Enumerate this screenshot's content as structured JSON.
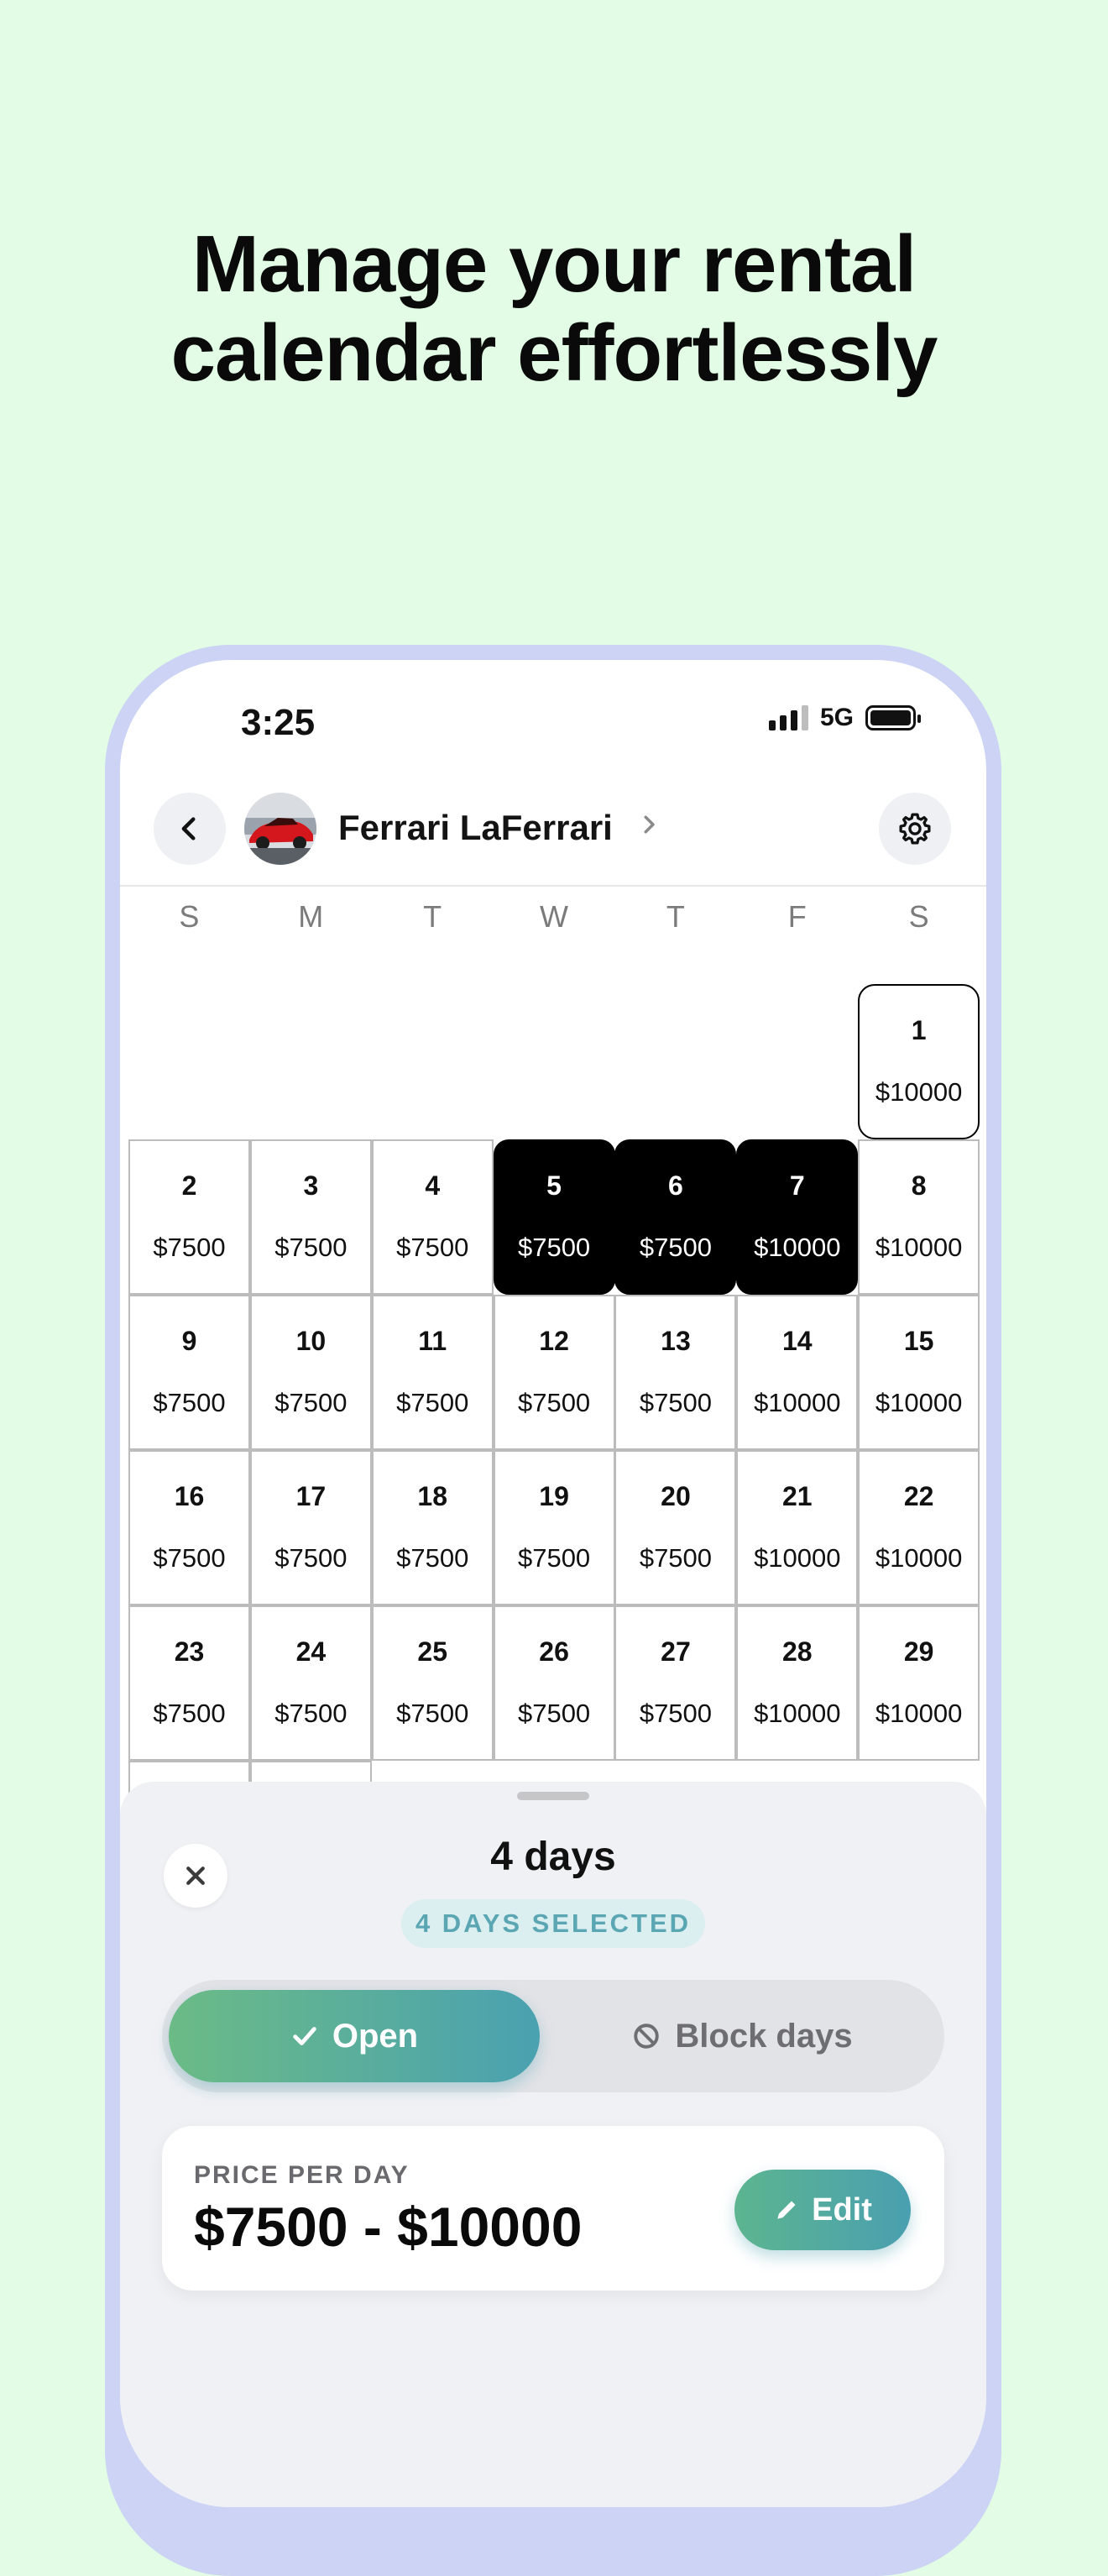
{
  "headline": {
    "line1": "Manage your rental",
    "line2": "calendar effortlessly"
  },
  "status_bar": {
    "time": "3:25",
    "network": "5G"
  },
  "header": {
    "car_name": "Ferrari LaFerrari"
  },
  "weekdays": [
    "S",
    "M",
    "T",
    "W",
    "T",
    "F",
    "S"
  ],
  "calendar": {
    "leading_blanks": 6,
    "days": [
      {
        "day": "1",
        "price": "$10000",
        "state": "today"
      },
      {
        "day": "2",
        "price": "$7500",
        "state": "normal"
      },
      {
        "day": "3",
        "price": "$7500",
        "state": "normal"
      },
      {
        "day": "4",
        "price": "$7500",
        "state": "normal"
      },
      {
        "day": "5",
        "price": "$7500",
        "state": "selected"
      },
      {
        "day": "6",
        "price": "$7500",
        "state": "selected"
      },
      {
        "day": "7",
        "price": "$10000",
        "state": "selected"
      },
      {
        "day": "8",
        "price": "$10000",
        "state": "normal"
      },
      {
        "day": "9",
        "price": "$7500",
        "state": "normal"
      },
      {
        "day": "10",
        "price": "$7500",
        "state": "normal"
      },
      {
        "day": "11",
        "price": "$7500",
        "state": "normal"
      },
      {
        "day": "12",
        "price": "$7500",
        "state": "normal"
      },
      {
        "day": "13",
        "price": "$7500",
        "state": "normal"
      },
      {
        "day": "14",
        "price": "$10000",
        "state": "normal"
      },
      {
        "day": "15",
        "price": "$10000",
        "state": "normal"
      },
      {
        "day": "16",
        "price": "$7500",
        "state": "normal"
      },
      {
        "day": "17",
        "price": "$7500",
        "state": "normal"
      },
      {
        "day": "18",
        "price": "$7500",
        "state": "normal"
      },
      {
        "day": "19",
        "price": "$7500",
        "state": "normal"
      },
      {
        "day": "20",
        "price": "$7500",
        "state": "normal"
      },
      {
        "day": "21",
        "price": "$10000",
        "state": "normal"
      },
      {
        "day": "22",
        "price": "$10000",
        "state": "normal"
      },
      {
        "day": "23",
        "price": "$7500",
        "state": "normal"
      },
      {
        "day": "24",
        "price": "$7500",
        "state": "normal"
      },
      {
        "day": "25",
        "price": "$7500",
        "state": "normal"
      },
      {
        "day": "26",
        "price": "$7500",
        "state": "normal"
      },
      {
        "day": "27",
        "price": "$7500",
        "state": "normal"
      },
      {
        "day": "28",
        "price": "$10000",
        "state": "normal"
      },
      {
        "day": "29",
        "price": "$10000",
        "state": "normal"
      }
    ]
  },
  "sheet": {
    "title": "4 days",
    "badge": "4 DAYS SELECTED",
    "open_label": "Open",
    "block_label": "Block days",
    "price_label": "PRICE PER DAY",
    "price_range": "$7500 - $10000",
    "edit_label": "Edit"
  },
  "colors": {
    "background": "#e2fce5",
    "accent_start": "#6bbb86",
    "accent_end": "#4aa1b0",
    "selected_day": "#000000"
  }
}
